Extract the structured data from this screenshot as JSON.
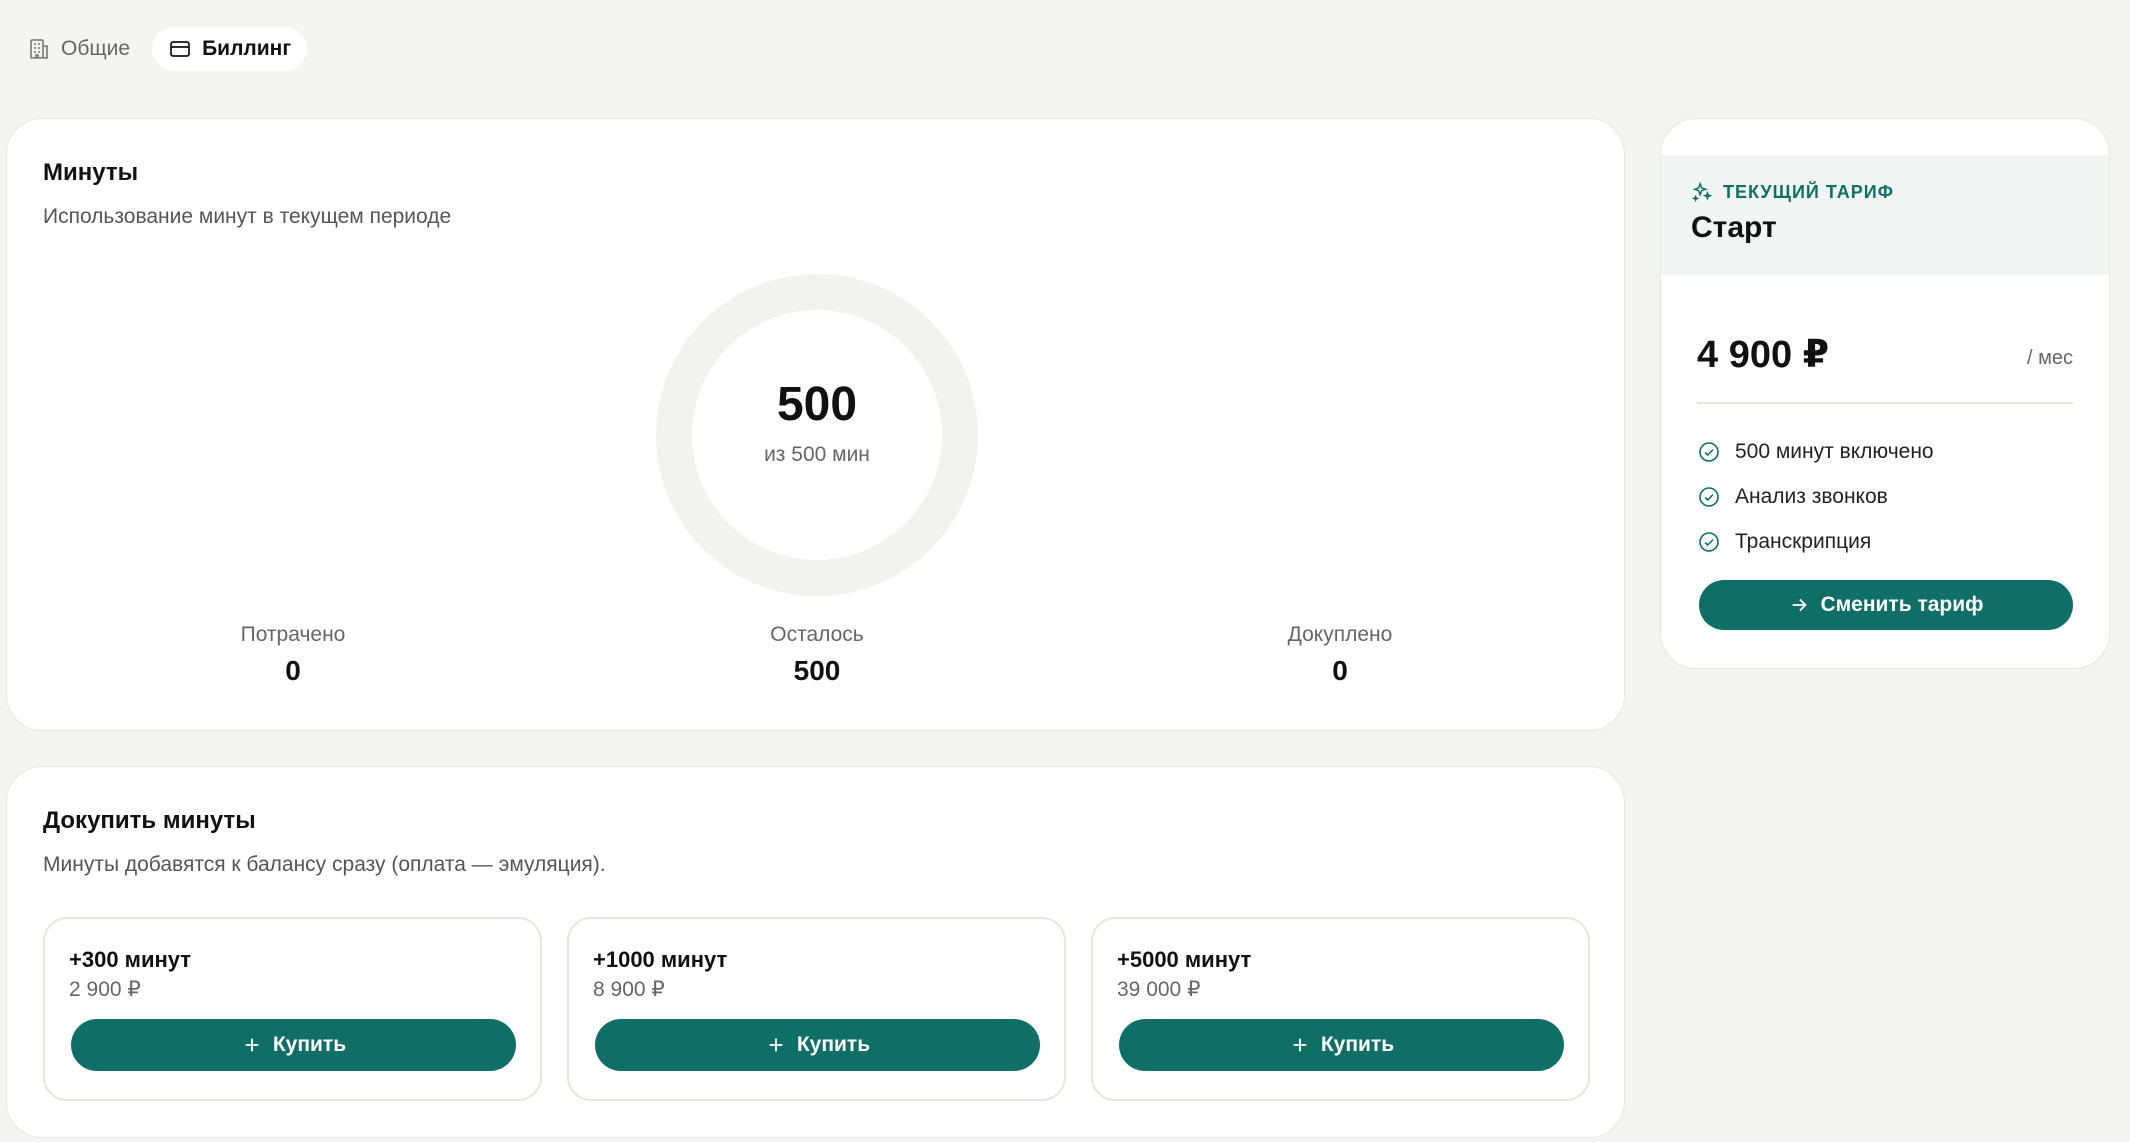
{
  "tabs": [
    {
      "label": "Общие",
      "icon": "building-icon",
      "active": false
    },
    {
      "label": "Биллинг",
      "icon": "credit-card-icon",
      "active": true
    }
  ],
  "minutes": {
    "title": "Минуты",
    "subtitle": "Использование минут в текущем периоде",
    "ring": {
      "value": "500",
      "caption": "из 500 мин",
      "used_fraction": 0
    },
    "stats": [
      {
        "label": "Потрачено",
        "value": "0"
      },
      {
        "label": "Осталось",
        "value": "500"
      },
      {
        "label": "Докуплено",
        "value": "0"
      }
    ]
  },
  "topup": {
    "title": "Докупить минуты",
    "subtitle": "Минуты добавятся к балансу сразу (оплата — эмуляция).",
    "offers": [
      {
        "title": "+300 минут",
        "price": "2 900 ₽",
        "button": "Купить"
      },
      {
        "title": "+1000 минут",
        "price": "8 900 ₽",
        "button": "Купить"
      },
      {
        "title": "+5000 минут",
        "price": "39 000 ₽",
        "button": "Купить"
      }
    ]
  },
  "plan": {
    "badge": "ТЕКУЩИЙ ТАРИФ",
    "name": "Старт",
    "price": "4 900 ₽",
    "period": "/ мес",
    "features": [
      "500 минут включено",
      "Анализ звонков",
      "Транскрипция"
    ],
    "button": "Сменить тариф"
  },
  "colors": {
    "accent": "#0f6f66",
    "background": "#f4f4f2",
    "card": "#ffffff",
    "ring_track": "#f2f2ef"
  }
}
